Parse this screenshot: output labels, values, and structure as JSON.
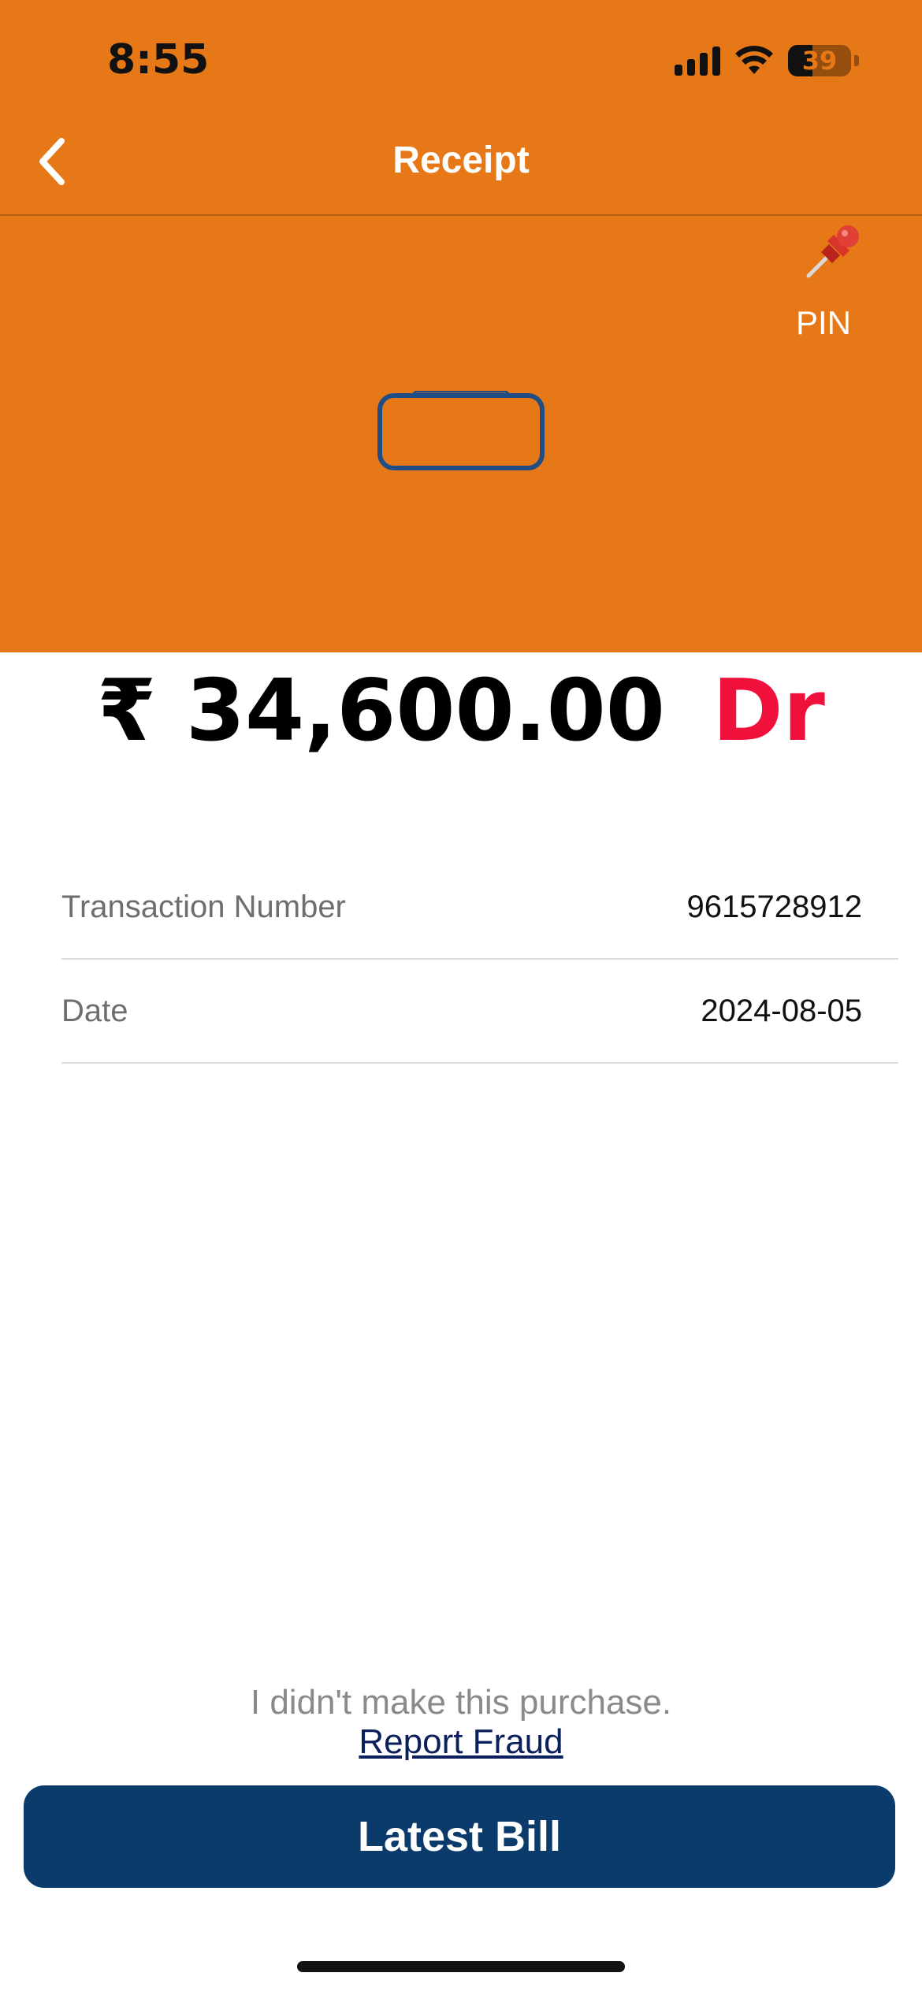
{
  "status_bar": {
    "time": "8:55",
    "battery_level": "39",
    "signal_icon": "cellular-signal-icon",
    "wifi_icon": "wifi-icon"
  },
  "nav": {
    "title": "Receipt",
    "back_icon": "chevron-left-icon"
  },
  "pin": {
    "label": "PIN",
    "icon": "pushpin-icon"
  },
  "transaction": {
    "amount": "₹ 34,600.00",
    "type": "Dr",
    "details": [
      {
        "label": "Transaction Number",
        "value": "9615728912"
      },
      {
        "label": "Date",
        "value": "2024-08-05"
      }
    ]
  },
  "footer": {
    "fraud_text": "I didn't make this purchase.",
    "fraud_link": "Report Fraud",
    "latest_bill_label": "Latest Bill"
  },
  "colors": {
    "header_background": "#E67818",
    "debit_indicator": "#F0103C",
    "primary_button": "#0B3B6B"
  }
}
